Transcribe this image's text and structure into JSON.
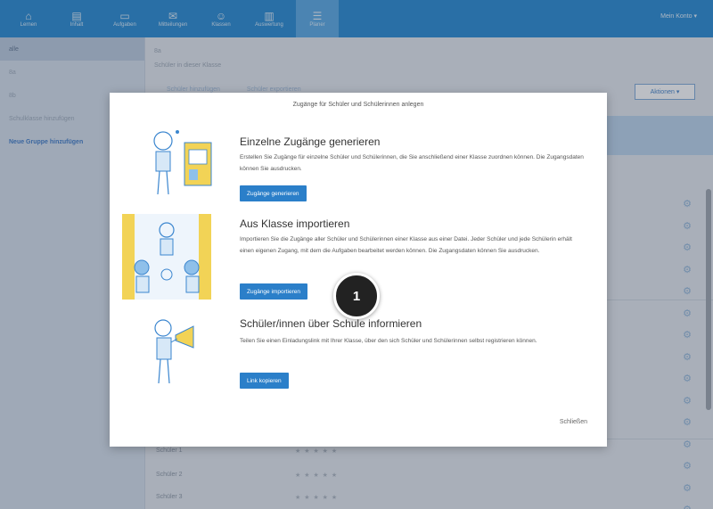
{
  "nav": {
    "items": [
      {
        "label": "Lernen",
        "icon": "home-icon",
        "active": false
      },
      {
        "label": "Inhalt",
        "icon": "document-icon",
        "active": false
      },
      {
        "label": "Aufgaben",
        "icon": "tasks-icon",
        "active": false
      },
      {
        "label": "Mitteilungen",
        "icon": "message-icon",
        "active": false
      },
      {
        "label": "Klassen",
        "icon": "people-icon",
        "active": false
      },
      {
        "label": "Auswertung",
        "icon": "chart-icon",
        "active": false
      },
      {
        "label": "Planer",
        "icon": "planner-icon",
        "active": true
      }
    ],
    "user": "Mein Konto ▾"
  },
  "sidebar": {
    "items": [
      {
        "label": "alle",
        "style": "sel"
      },
      {
        "label": "8a",
        "style": ""
      },
      {
        "label": "8b",
        "style": ""
      },
      {
        "label": "Schulklasse hinzufügen",
        "style": ""
      },
      {
        "label": "Neue Gruppe hinzufügen",
        "style": "blue"
      }
    ]
  },
  "main": {
    "crumb1": "8a",
    "crumb2": "Schüler in dieser Klasse",
    "links": [
      "Schüler hinzufügen",
      "Schüler exportieren"
    ],
    "aktion": "Aktionen ▾",
    "rows": [
      {
        "name": "Schüler 1",
        "stars": "★ ★ ★ ★ ★"
      },
      {
        "name": "Schüler 2",
        "stars": "★ ★ ★ ★ ★"
      },
      {
        "name": "Schüler 3",
        "stars": "★ ★ ★ ★ ★"
      }
    ]
  },
  "modal": {
    "title": "Zugänge für Schüler und Schülerinnen anlegen",
    "s1_title": "Einzelne Zugänge generieren",
    "s1_text": "Erstellen Sie Zugänge für einzelne Schüler und Schülerinnen, die Sie anschließend einer Klasse zuordnen können. Die Zugangsdaten können Sie ausdrucken.",
    "s1_btn": "Zugänge generieren",
    "s2_title": "Aus Klasse importieren",
    "s2_text": "Importieren Sie die Zugänge aller Schüler und Schülerinnen einer Klasse aus einer Datei. Jeder Schüler und jede Schülerin erhält einen eigenen Zugang, mit dem die Aufgaben bearbeitet werden können. Die Zugangsdaten können Sie ausdrucken.",
    "s2_btn": "Zugänge importieren",
    "s3_title": "Schüler/innen über Schule informieren",
    "s3_text": "Teilen Sie einen Einladungslink mit Ihrer Klasse, über den sich Schüler und Schülerinnen selbst registrieren können.",
    "s3_btn": "Link kopieren",
    "close": "Schließen"
  },
  "step": "1"
}
